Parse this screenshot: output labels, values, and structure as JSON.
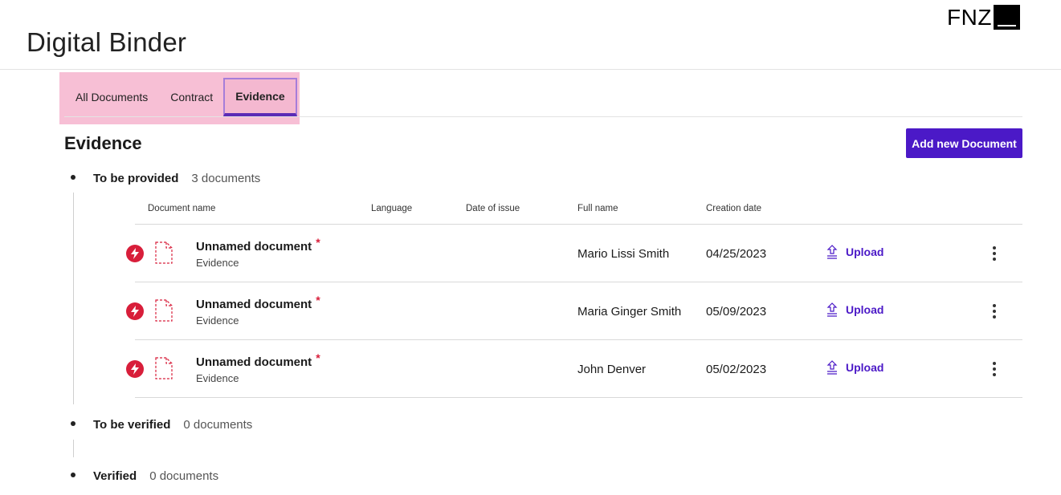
{
  "app": {
    "title": "Digital Binder",
    "logo_text": "FNZ"
  },
  "tabs": [
    {
      "label": "All Documents",
      "active": false
    },
    {
      "label": "Contract",
      "active": false
    },
    {
      "label": "Evidence",
      "active": true
    }
  ],
  "section": {
    "title": "Evidence",
    "add_button_label": "Add new Document"
  },
  "groups": [
    {
      "label": "To be provided",
      "count": "3 documents"
    },
    {
      "label": "To be verified",
      "count": "0 documents"
    },
    {
      "label": "Verified",
      "count": "0 documents"
    }
  ],
  "table": {
    "columns": {
      "document_name": "Document name",
      "language": "Language",
      "date_of_issue": "Date of issue",
      "full_name": "Full name",
      "creation_date": "Creation date"
    },
    "rows": [
      {
        "name": "Unnamed document",
        "required_mark": "*",
        "type": "Evidence",
        "full_name": "Mario Lissi Smith",
        "creation_date": "04/25/2023",
        "action": "Upload"
      },
      {
        "name": "Unnamed document",
        "required_mark": "*",
        "type": "Evidence",
        "full_name": "Maria Ginger Smith",
        "creation_date": "05/09/2023",
        "action": "Upload"
      },
      {
        "name": "Unnamed document",
        "required_mark": "*",
        "type": "Evidence",
        "full_name": "John Denver",
        "creation_date": "05/02/2023",
        "action": "Upload"
      }
    ]
  },
  "colors": {
    "accent": "#4b19c7",
    "alert": "#d81e3a",
    "tab_highlight": "#f7bfd5"
  },
  "icons": {
    "alert": "lightning-alert-icon",
    "document": "dashed-document-icon",
    "upload": "upload-icon",
    "more": "kebab-menu-icon"
  }
}
